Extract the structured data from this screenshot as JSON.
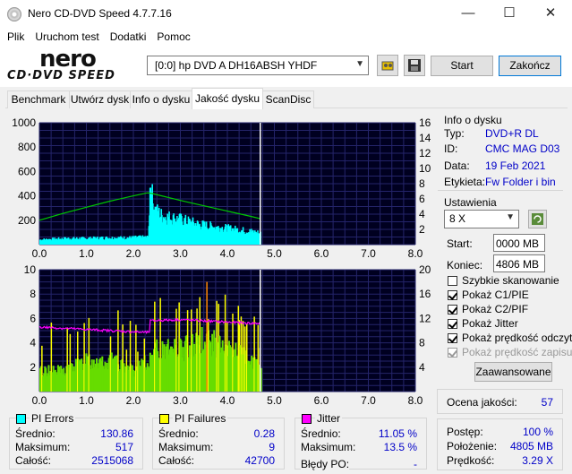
{
  "window": {
    "title": "Nero CD-DVD Speed 4.7.7.16",
    "minimize": "—",
    "maximize": "☐",
    "close": "✕"
  },
  "menu": [
    "Plik",
    "Uruchom test",
    "Dodatki",
    "Pomoc"
  ],
  "logo": {
    "top": "nero",
    "bottom": "CD·DVD SPEED"
  },
  "toolbar": {
    "drive": "[0:0]   hp DVD A  DH16ABSH YHDF",
    "start": "Start",
    "end": "Zakończ",
    "icons": [
      "eject-icon",
      "save-icon"
    ]
  },
  "tabs": [
    "Benchmark",
    "Utwórz dysk",
    "Info o dysku",
    "Jakość dysku",
    "ScanDisc"
  ],
  "active_tab": "Jakość dysku",
  "disc_info": {
    "header": "Info o dysku",
    "rows": [
      {
        "label": "Typ:",
        "value": "DVD+R DL"
      },
      {
        "label": "ID:",
        "value": "CMC MAG D03"
      },
      {
        "label": "Data:",
        "value": "19 Feb 2021"
      },
      {
        "label": "Etykieta:",
        "value": "Fw Folder i bin"
      }
    ]
  },
  "settings": {
    "header": "Ustawienia",
    "speed": "8 X",
    "start_label": "Start:",
    "start_value": "0000 MB",
    "end_label": "Koniec:",
    "end_value": "4806 MB",
    "checkboxes": [
      {
        "label": "Szybkie skanowanie",
        "checked": false,
        "enabled": true
      },
      {
        "label": "Pokaż C1/PIE",
        "checked": true,
        "enabled": true
      },
      {
        "label": "Pokaż C2/PIF",
        "checked": true,
        "enabled": true
      },
      {
        "label": "Pokaż Jitter",
        "checked": true,
        "enabled": true
      },
      {
        "label": "Pokaż prędkość odczytu",
        "checked": true,
        "enabled": true
      },
      {
        "label": "Pokaż prędkość zapisu",
        "checked": true,
        "enabled": false
      }
    ],
    "advanced": "Zaawansowane"
  },
  "quality": {
    "label": "Ocena jakości:",
    "value": "57"
  },
  "progress": {
    "rows": [
      {
        "label": "Postęp:",
        "value": "100 %"
      },
      {
        "label": "Położenie:",
        "value": "4805 MB"
      },
      {
        "label": "Prędkość:",
        "value": "3.29 X"
      }
    ]
  },
  "pi_errors": {
    "title": "PI Errors",
    "color": "#00ffff",
    "rows": [
      {
        "label": "Średnio:",
        "value": "130.86"
      },
      {
        "label": "Maksimum:",
        "value": "517"
      },
      {
        "label": "Całość:",
        "value": "2515068"
      }
    ]
  },
  "pi_failures": {
    "title": "PI Failures",
    "color": "#ffff00",
    "rows": [
      {
        "label": "Średnio:",
        "value": "0.28"
      },
      {
        "label": "Maksimum:",
        "value": "9"
      },
      {
        "label": "Całość:",
        "value": "42700"
      }
    ]
  },
  "jitter": {
    "title": "Jitter",
    "color": "#ff00ff",
    "rows": [
      {
        "label": "Średnio:",
        "value": "11.05 %"
      },
      {
        "label": "Maksimum:",
        "value": "13.5 %"
      },
      {
        "label": "Błędy PO:",
        "value": "-"
      }
    ]
  },
  "chart_data": [
    {
      "type": "area",
      "x_ticks": [
        "0.0",
        "1.0",
        "2.0",
        "3.0",
        "4.0",
        "5.0",
        "6.0",
        "7.0",
        "8.0"
      ],
      "y_left_ticks": [
        "1000",
        "800",
        "600",
        "400",
        "200"
      ],
      "y_right_ticks": [
        "16",
        "14",
        "12",
        "10",
        "8",
        "6",
        "4",
        "2"
      ],
      "xlim": [
        0,
        8
      ],
      "ylim_left": [
        0,
        1000
      ],
      "ylim_right": [
        0,
        16
      ],
      "scan_end": 4.7,
      "series": [
        {
          "name": "PI Errors",
          "color": "#00ffff",
          "x": [
            0.0,
            0.3,
            0.6,
            1.0,
            1.4,
            1.8,
            2.2,
            2.3,
            2.35,
            2.45,
            2.6,
            3.0,
            3.4,
            3.8,
            4.2,
            4.5,
            4.7
          ],
          "y": [
            40,
            45,
            50,
            50,
            55,
            55,
            60,
            60,
            390,
            280,
            230,
            200,
            160,
            140,
            120,
            105,
            90
          ]
        },
        {
          "name": "Read speed",
          "color": "#00c800",
          "x": [
            0.0,
            0.5,
            1.0,
            1.5,
            2.0,
            2.3,
            2.4,
            3.0,
            3.5,
            4.0,
            4.5,
            4.7
          ],
          "y": [
            3.2,
            4.1,
            4.9,
            5.7,
            6.4,
            6.8,
            6.7,
            5.8,
            5.1,
            4.4,
            3.7,
            3.4
          ]
        }
      ]
    },
    {
      "type": "bar",
      "x_ticks": [
        "0.0",
        "1.0",
        "2.0",
        "3.0",
        "4.0",
        "5.0",
        "6.0",
        "7.0",
        "8.0"
      ],
      "y_left_ticks": [
        "10",
        "8",
        "6",
        "4",
        "2"
      ],
      "y_right_ticks": [
        "20",
        "16",
        "12",
        "8",
        "4"
      ],
      "xlim": [
        0,
        8
      ],
      "ylim_left": [
        0,
        10
      ],
      "ylim_right": [
        0,
        20
      ],
      "scan_end": 4.7,
      "series": [
        {
          "name": "PI Failures",
          "color": "#ffff00",
          "x": [
            0.0,
            0.5,
            1.0,
            1.5,
            2.0,
            2.3,
            2.5,
            3.0,
            3.5,
            4.0,
            4.5,
            4.7
          ],
          "y": [
            2,
            2,
            3,
            3,
            2,
            3,
            4,
            4,
            5,
            4,
            3,
            2
          ]
        },
        {
          "name": "Jitter",
          "color": "#ff00ff",
          "x": [
            0.0,
            0.5,
            1.0,
            1.5,
            2.0,
            2.3,
            2.35,
            2.6,
            3.0,
            3.5,
            4.0,
            4.5,
            4.7
          ],
          "y": [
            10.6,
            10.4,
            10.2,
            10.0,
            9.8,
            9.7,
            11.6,
            11.7,
            11.8,
            11.6,
            11.4,
            11.2,
            11.2
          ]
        }
      ]
    }
  ]
}
